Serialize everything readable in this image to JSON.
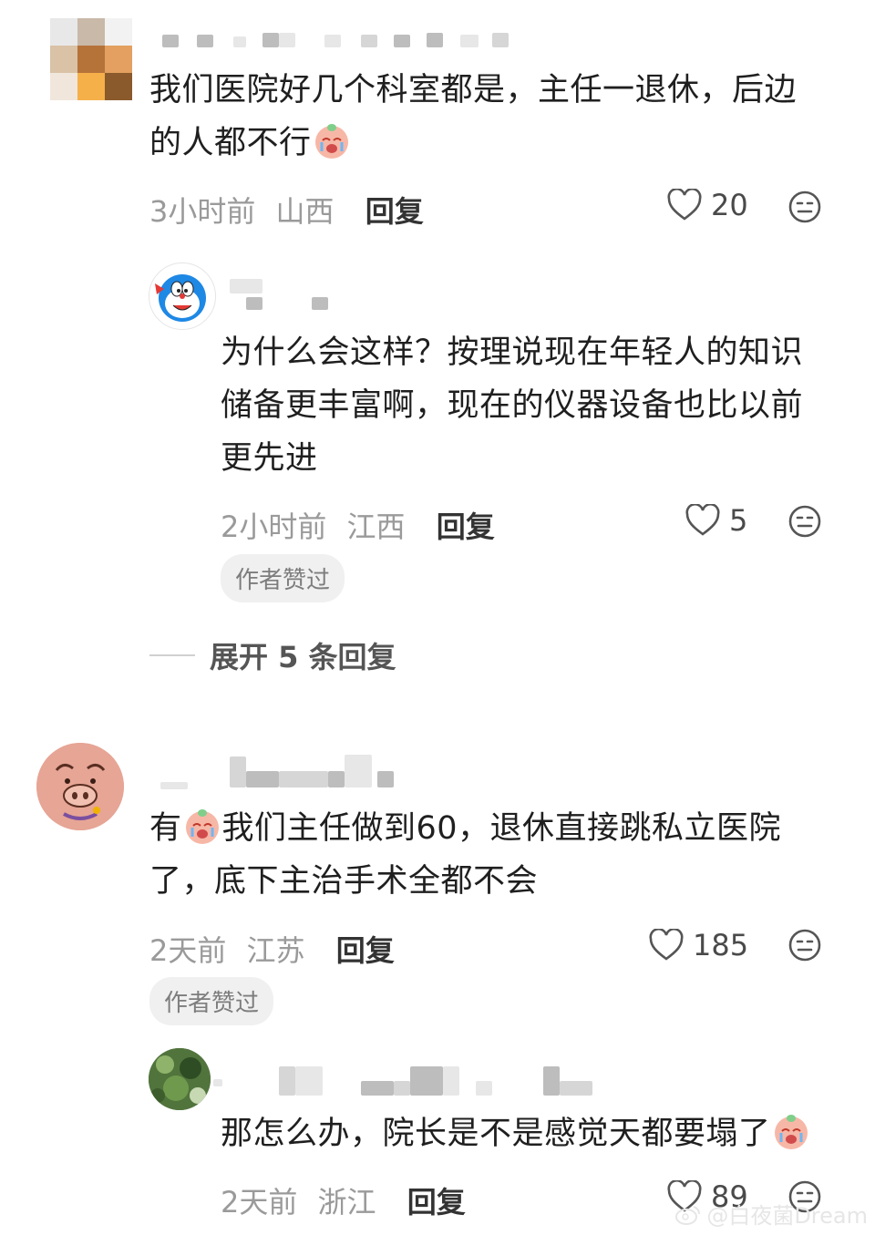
{
  "comments": [
    {
      "text_line1": "我们医院好几个科室都是，主任一退休，后边",
      "text_line2": "的人都不行",
      "time": "3小时前",
      "region": "山西",
      "reply_label": "回复",
      "likes": "20",
      "replies": [
        {
          "text_line1": "为什么会这样？按理说现在年轻人的知识",
          "text_line2": "储备更丰富啊，现在的仪器设备也比以前",
          "text_line3": "更先进",
          "time": "2小时前",
          "region": "江西",
          "reply_label": "回复",
          "likes": "5",
          "badge": "作者赞过"
        }
      ],
      "expand_label": "展开 5 条回复"
    },
    {
      "text_prefix": "有",
      "text_line1_rest": "我们主任做到60，退休直接跳私立医院",
      "text_line2": "了，底下主治手术全都不会",
      "time": "2天前",
      "region": "江苏",
      "reply_label": "回复",
      "likes": "185",
      "badge": "作者赞过",
      "replies": [
        {
          "text_line1": "那怎么办，院长是不是感觉天都要塌了",
          "time": "2天前",
          "region": "浙江",
          "reply_label": "回复",
          "likes": "89"
        }
      ]
    }
  ],
  "watermark": "@白夜菌Dream",
  "colors": {
    "text": "#1f1f1f",
    "meta": "#9a9a9a",
    "badge_bg": "#f0f0f0"
  }
}
